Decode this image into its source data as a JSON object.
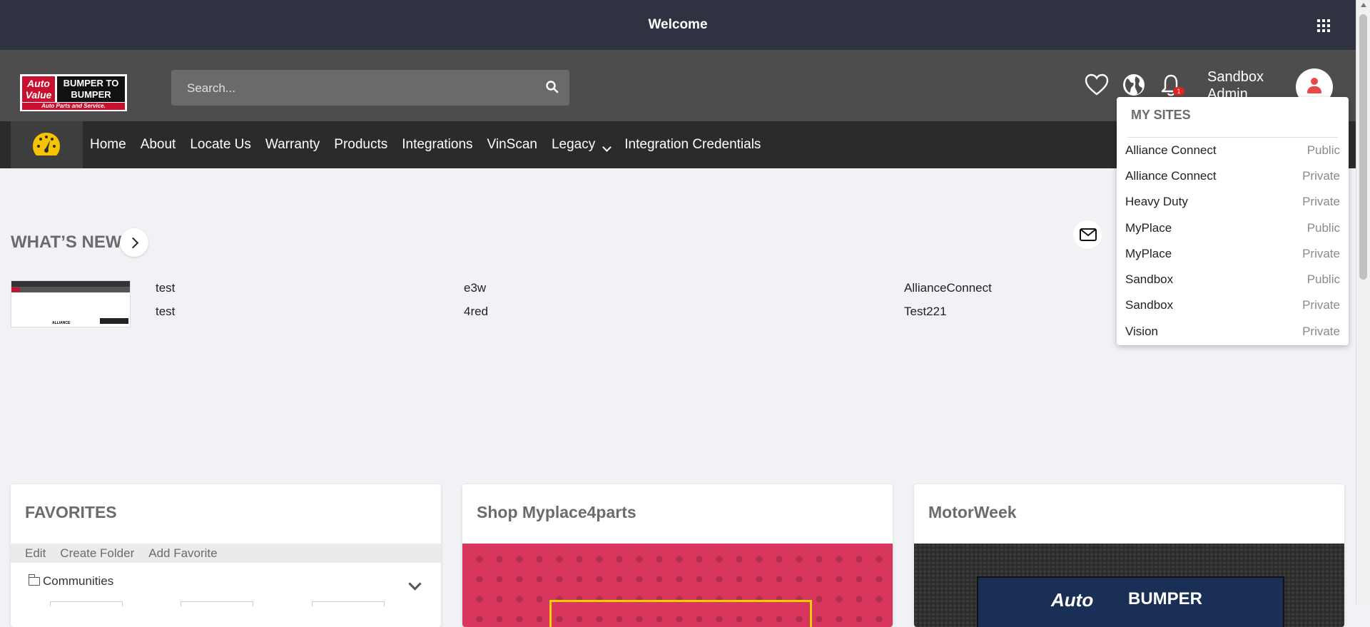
{
  "topbar": {
    "title": "Welcome"
  },
  "header": {
    "logo": {
      "line1": "Auto Value",
      "line2": "BUMPER TO BUMPER",
      "tagline": "Auto Parts and Service."
    },
    "search": {
      "placeholder": "Search..."
    },
    "notifications_count": "1",
    "user": {
      "name": "Sandbox Admin"
    }
  },
  "nav": {
    "items": [
      "Home",
      "About",
      "Locate Us",
      "Warranty",
      "Products",
      "Integrations",
      "VinScan",
      "Legacy",
      "Integration Credentials"
    ]
  },
  "whats_new": {
    "title": "WHAT’S NEW",
    "rows": [
      {
        "col1": "test",
        "col2": "e3w",
        "col3": "AllianceConnect"
      },
      {
        "col1": "test",
        "col2": "4red",
        "col3": "Test221"
      }
    ]
  },
  "my_sites": {
    "title": "MY SITES",
    "items": [
      {
        "name": "Alliance Connect",
        "visibility": "Public"
      },
      {
        "name": "Alliance Connect",
        "visibility": "Private"
      },
      {
        "name": "Heavy Duty",
        "visibility": "Private"
      },
      {
        "name": "MyPlace",
        "visibility": "Public"
      },
      {
        "name": "MyPlace",
        "visibility": "Private"
      },
      {
        "name": "Sandbox",
        "visibility": "Public"
      },
      {
        "name": "Sandbox",
        "visibility": "Private"
      },
      {
        "name": "Vision",
        "visibility": "Private"
      }
    ]
  },
  "favorites": {
    "title": "FAVORITES",
    "tools": [
      "Edit",
      "Create Folder",
      "Add Favorite"
    ],
    "folder": "Communities"
  },
  "shop": {
    "title": "Shop Myplace4parts"
  },
  "motorweek": {
    "title": "MotorWeek",
    "banner_left": "Auto",
    "banner_right": "BUMPER"
  },
  "colors": {
    "topbar": "#2f3240",
    "header": "#4d4d4d",
    "nav": "#2b2b2b",
    "brand_red": "#c8102e",
    "badge": "#e02424",
    "shop_banner": "#d9365e"
  }
}
